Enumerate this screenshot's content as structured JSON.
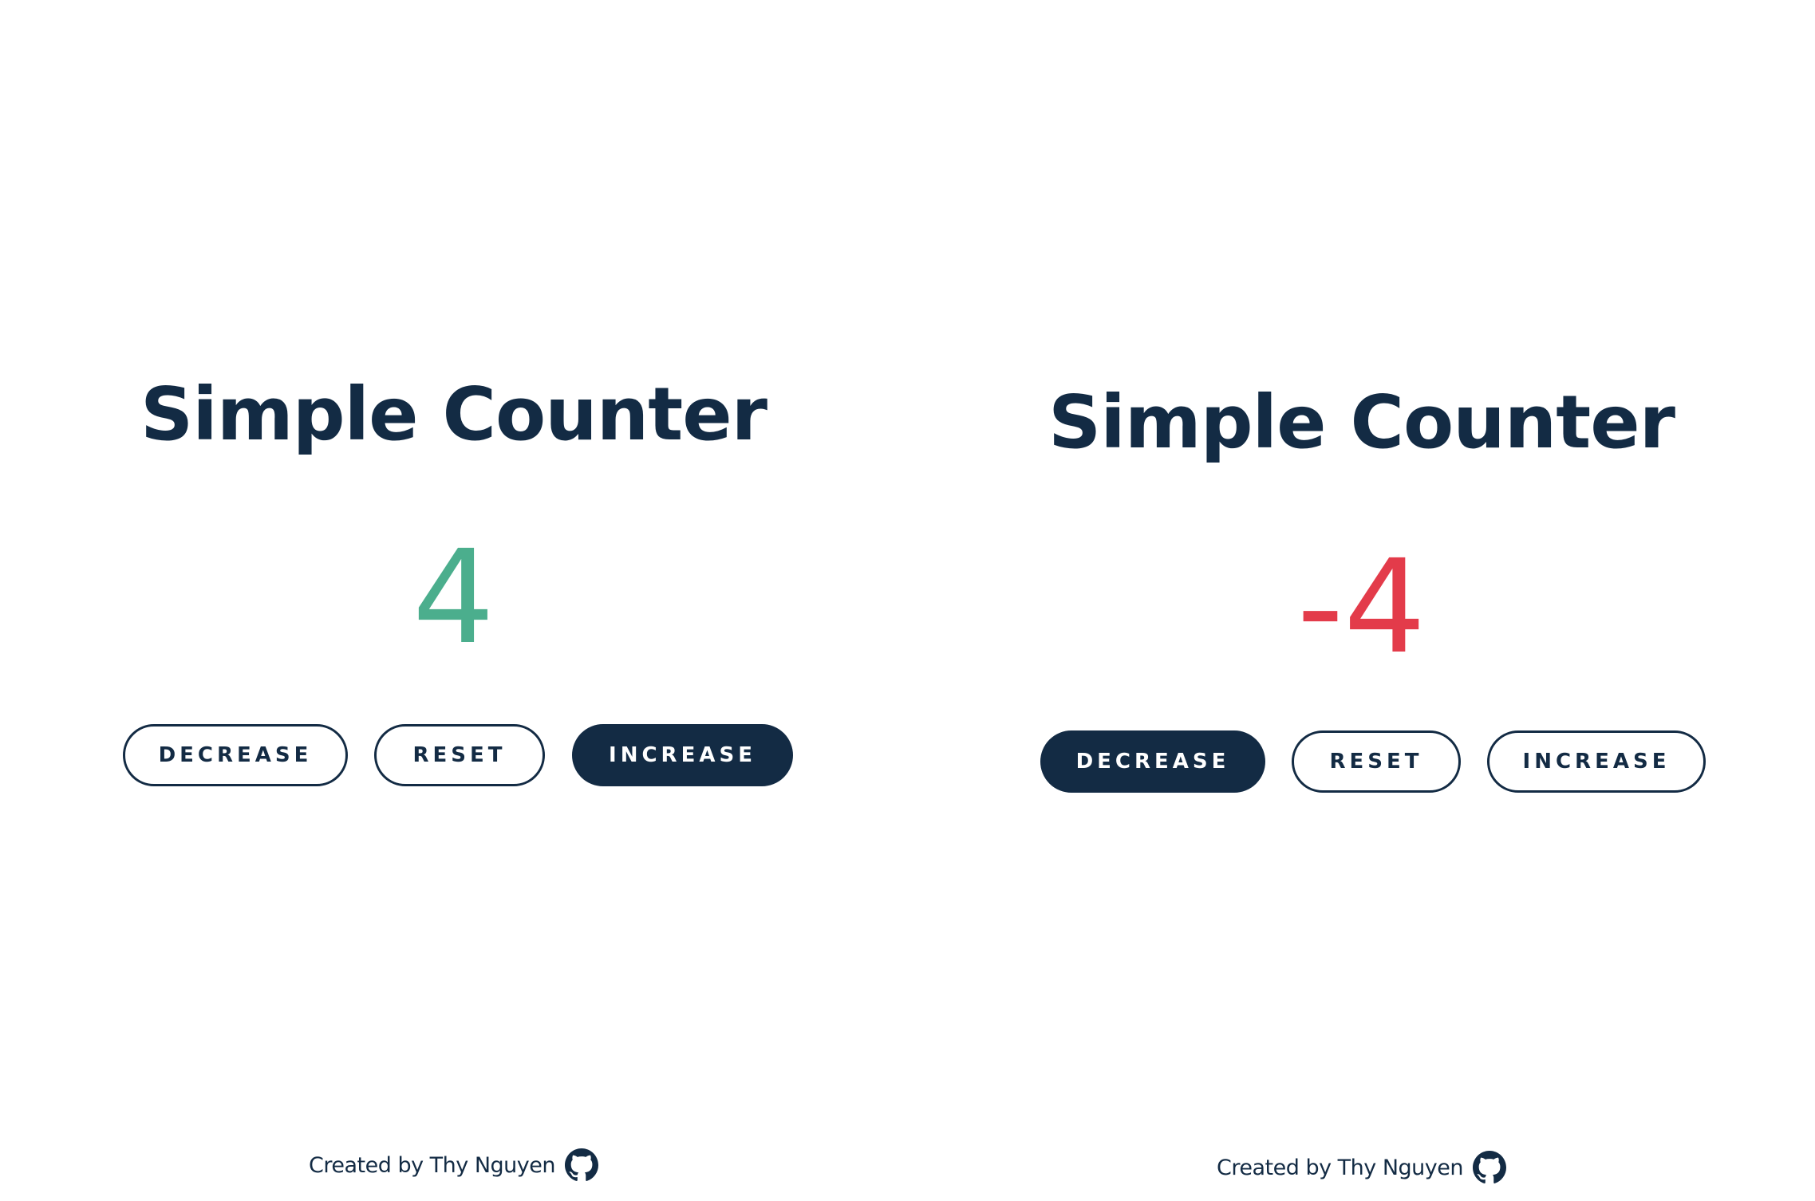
{
  "panels": [
    {
      "title": "Simple Counter",
      "count": "4",
      "count_state": "positive",
      "buttons": {
        "decrease": "DECREASE",
        "reset": "RESET",
        "increase": "INCREASE"
      },
      "active_button": "increase",
      "footer_text": "Created by Thy Nguyen",
      "footer_icon": "github-icon"
    },
    {
      "title": "Simple Counter",
      "count": "-4",
      "count_state": "negative",
      "buttons": {
        "decrease": "DECREASE",
        "reset": "RESET",
        "increase": "INCREASE"
      },
      "active_button": "decrease",
      "footer_text": "Created by Thy Nguyen",
      "footer_icon": "github-icon"
    }
  ],
  "colors": {
    "navy": "#132b44",
    "positive": "#4bae8d",
    "negative": "#e33b4a",
    "background": "#ffffff"
  }
}
